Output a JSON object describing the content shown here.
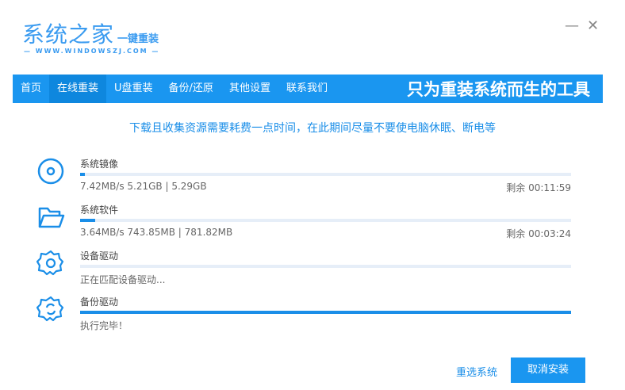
{
  "app": {
    "logo_main": "系统之家",
    "logo_sub": "一键重装",
    "logo_url": "— WWW.WINDOWSZJ.COM —",
    "minimize": "—",
    "close": "✕"
  },
  "nav": {
    "items": [
      {
        "label": "首页"
      },
      {
        "label": "在线重装",
        "active": true
      },
      {
        "label": "U盘重装"
      },
      {
        "label": "备份/还原"
      },
      {
        "label": "其他设置"
      },
      {
        "label": "联系我们"
      }
    ],
    "slogan": "只为重装系统而生的工具"
  },
  "notice": "下载且收集资源需要耗费一点时间，在此期间尽量不要使电脑休眠、断电等",
  "tasks": [
    {
      "name": "系统镜像",
      "icon": "disc-icon",
      "progress_percent": 1,
      "info": "7.42MB/s 5.21GB | 5.29GB",
      "remain": "剩余 00:11:59"
    },
    {
      "name": "系统软件",
      "icon": "folder-icon",
      "progress_percent": 3,
      "info": "3.64MB/s 743.85MB | 781.82MB",
      "remain": "剩余 00:03:24"
    },
    {
      "name": "设备驱动",
      "icon": "gear-icon",
      "progress_percent": 0,
      "info": "正在匹配设备驱动..."
    },
    {
      "name": "备份驱动",
      "icon": "gear-sync-icon",
      "progress_percent": 100,
      "info": "执行完毕！"
    }
  ],
  "buttons": {
    "reselect": "重选系统",
    "cancel": "取消安装"
  },
  "colors": {
    "accent": "#1a96f0",
    "track": "#e6eef8"
  }
}
